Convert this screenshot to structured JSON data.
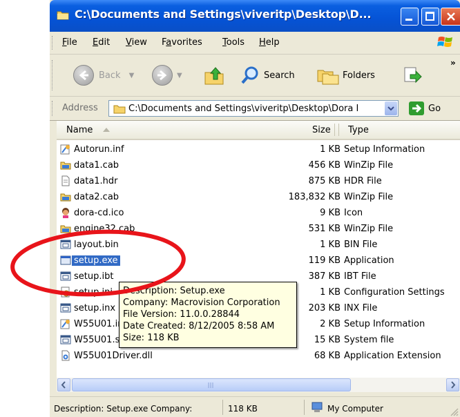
{
  "window": {
    "title": "C:\\Documents and Settings\\viveritp\\Desktop\\D...",
    "colors": {
      "titlebar": "#0553d6",
      "selection": "#316ac5",
      "tooltip_bg": "#ffffe1",
      "annotation": "#e8141a"
    }
  },
  "menu": {
    "items": [
      {
        "key": "File",
        "mnemonic": "F",
        "rest": "ile"
      },
      {
        "key": "Edit",
        "mnemonic": "E",
        "rest": "dit"
      },
      {
        "key": "View",
        "mnemonic": "V",
        "rest": "iew"
      },
      {
        "key": "Favorites",
        "mnemonic": "a",
        "pre": "F",
        "rest": "vorites"
      },
      {
        "key": "Tools",
        "mnemonic": "T",
        "rest": "ools"
      },
      {
        "key": "Help",
        "mnemonic": "H",
        "rest": "elp"
      }
    ]
  },
  "toolbar": {
    "back_label": "Back",
    "search_label": "Search",
    "folders_label": "Folders",
    "more_label": "»"
  },
  "address": {
    "label": "Address",
    "value": "C:\\Documents and Settings\\viveritp\\Desktop\\Dora I",
    "go_label": "Go"
  },
  "columns": {
    "name": "Name",
    "size": "Size",
    "type": "Type"
  },
  "files": [
    {
      "name": "Autorun.inf",
      "size": "1 KB",
      "type": "Setup Information",
      "icon": "setup-info-icon"
    },
    {
      "name": "data1.cab",
      "size": "456 KB",
      "type": "WinZip File",
      "icon": "winzip-icon"
    },
    {
      "name": "data1.hdr",
      "size": "875 KB",
      "type": "HDR File",
      "icon": "generic-file-icon"
    },
    {
      "name": "data2.cab",
      "size": "183,832 KB",
      "type": "WinZip File",
      "icon": "winzip-icon"
    },
    {
      "name": "dora-cd.ico",
      "size": "9 KB",
      "type": "Icon",
      "icon": "dora-icon"
    },
    {
      "name": "engine32.cab",
      "size": "531 KB",
      "type": "WinZip File",
      "icon": "winzip-icon"
    },
    {
      "name": "layout.bin",
      "size": "1 KB",
      "type": "BIN File",
      "icon": "bin-file-icon"
    },
    {
      "name": "setup.exe",
      "size": "119 KB",
      "type": "Application",
      "icon": "application-icon"
    },
    {
      "name": "setup.ibt",
      "size": "387 KB",
      "type": "IBT File",
      "icon": "bin-file-icon"
    },
    {
      "name": "setup.ini",
      "size": "1 KB",
      "type": "Configuration Settings",
      "icon": "config-icon"
    },
    {
      "name": "setup.inx",
      "size": "203 KB",
      "type": "INX File",
      "icon": "bin-file-icon"
    },
    {
      "name": "W55U01.inf",
      "size": "2 KB",
      "type": "Setup Information",
      "icon": "setup-info-icon"
    },
    {
      "name": "W55U01.sys",
      "size": "15 KB",
      "type": "System file",
      "icon": "bin-file-icon"
    },
    {
      "name": "W55U01Driver.dll",
      "size": "68 KB",
      "type": "Application Extension",
      "icon": "dll-icon"
    }
  ],
  "selected_index": 7,
  "tooltip": {
    "description": "Description: Setup.exe",
    "company": "Company: Macrovision Corporation",
    "version": "File Version: 11.0.0.28844",
    "created": "Date Created: 8/12/2005 8:58 AM",
    "size": "Size: 118 KB"
  },
  "status": {
    "text": "Description: Setup.exe Company:",
    "size": "118 KB",
    "zone": "My Computer"
  }
}
